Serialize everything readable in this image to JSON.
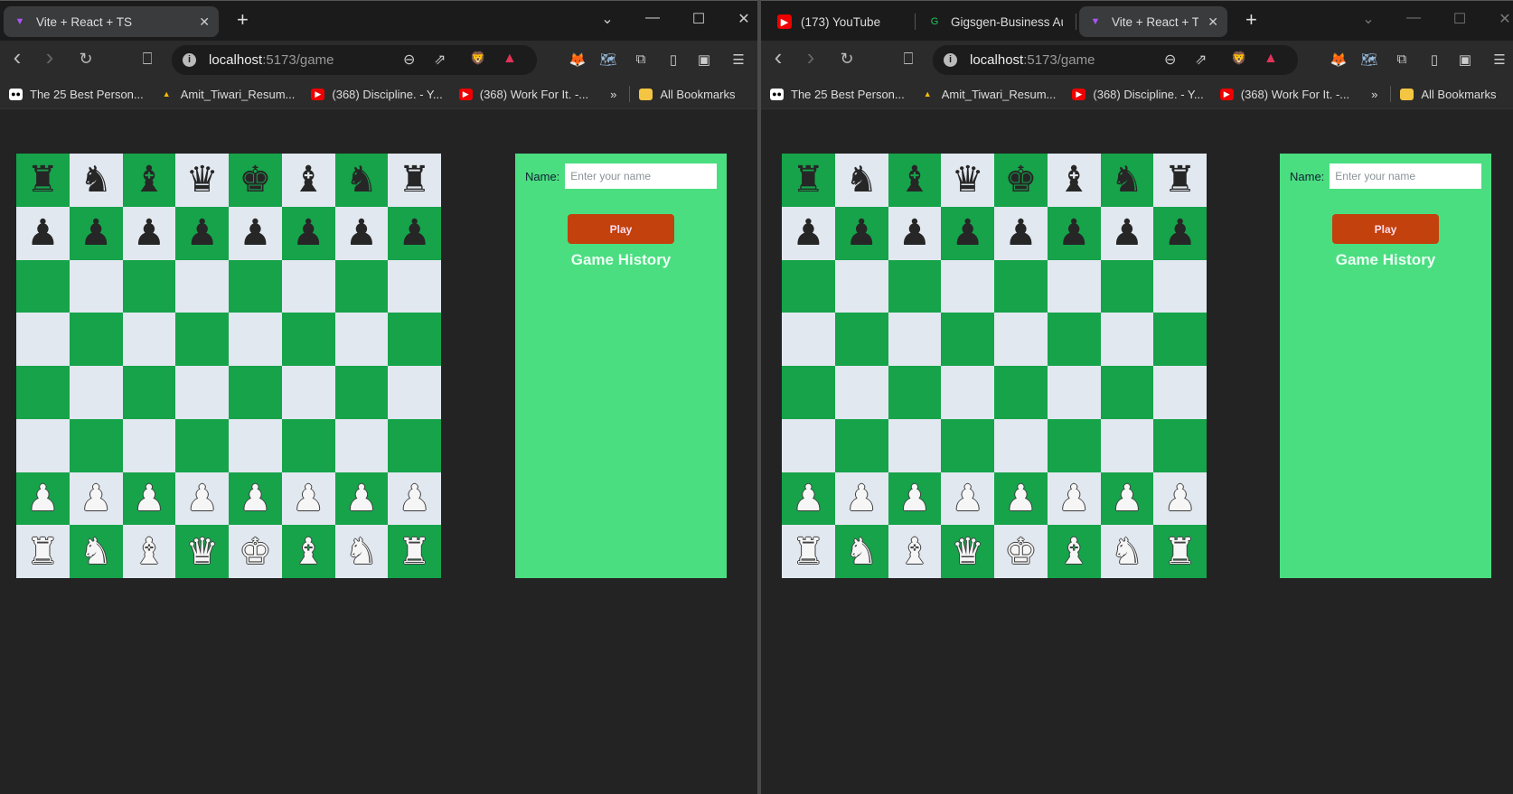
{
  "colors": {
    "dark_square": "#16a34a",
    "light_square": "#e2e8f0",
    "panel": "#4ade80",
    "play_button": "#c2410c"
  },
  "windows": [
    {
      "tabs": [
        {
          "label": "Vite + React + TS",
          "icon": "vite-icon",
          "active": true
        }
      ],
      "url_host": "localhost",
      "url_path": ":5173/game"
    },
    {
      "tabs": [
        {
          "label": "(173) YouTube",
          "icon": "youtube-icon",
          "active": false
        },
        {
          "label": "Gigsgen-Business Auto",
          "icon": "gigsgen-icon",
          "active": false
        },
        {
          "label": "Vite + React + TS",
          "icon": "vite-icon",
          "active": true
        }
      ],
      "url_host": "localhost",
      "url_path": ":5173/game"
    }
  ],
  "bookmarks": [
    {
      "label": "The 25 Best Person...",
      "icon": "medium-icon"
    },
    {
      "label": "Amit_Tiwari_Resum...",
      "icon": "google-drive-icon"
    },
    {
      "label": "(368) Discipline. - Y...",
      "icon": "youtube-icon"
    },
    {
      "label": "(368) Work For It. -...",
      "icon": "youtube-icon"
    }
  ],
  "bookmarks_more": "»",
  "all_bookmarks": "All Bookmarks",
  "board": [
    [
      "br",
      "bn",
      "bb",
      "bq",
      "bk",
      "bb",
      "bn",
      "br"
    ],
    [
      "bp",
      "bp",
      "bp",
      "bp",
      "bp",
      "bp",
      "bp",
      "bp"
    ],
    [
      "",
      "",
      "",
      "",
      "",
      "",
      "",
      ""
    ],
    [
      "",
      "",
      "",
      "",
      "",
      "",
      "",
      ""
    ],
    [
      "",
      "",
      "",
      "",
      "",
      "",
      "",
      ""
    ],
    [
      "",
      "",
      "",
      "",
      "",
      "",
      "",
      ""
    ],
    [
      "wp",
      "wp",
      "wp",
      "wp",
      "wp",
      "wp",
      "wp",
      "wp"
    ],
    [
      "wr",
      "wn",
      "wb",
      "wq",
      "wk",
      "wb",
      "wn",
      "wr"
    ]
  ],
  "panel": {
    "name_label": "Name:",
    "name_placeholder": "Enter your name",
    "name_value": "",
    "play_label": "Play",
    "history_title": "Game History"
  }
}
